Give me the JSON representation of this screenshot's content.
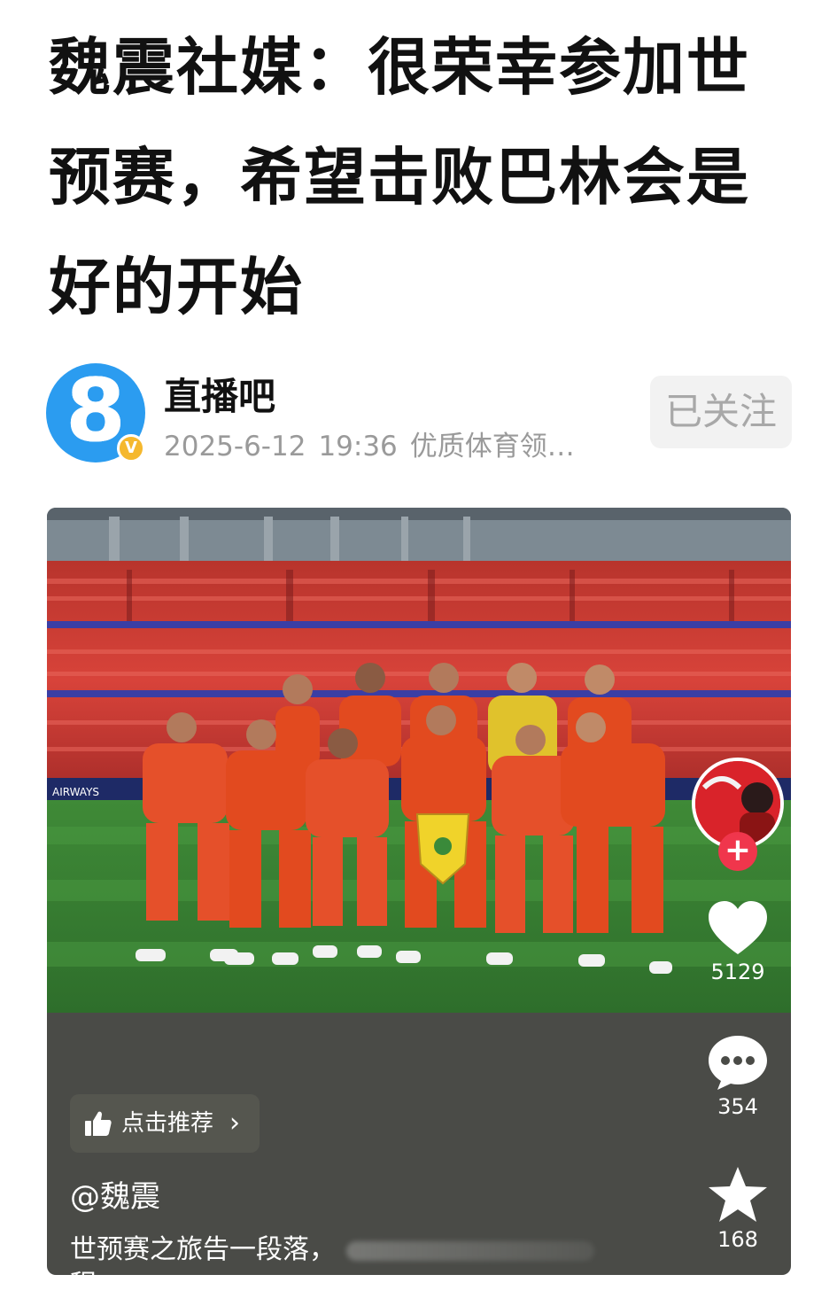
{
  "article": {
    "title": "魏震社媒：很荣幸参加世预赛，希望击败巴林会是好的开始"
  },
  "author": {
    "avatar_text": "8",
    "name": "直播吧",
    "date": "2025-6-12",
    "time": "19:36",
    "tagline": "优质体育领…",
    "follow_label": "已关注",
    "verified_icon": "verified-badge-icon"
  },
  "video": {
    "like_count": "5129",
    "comment_count": "354",
    "favorite_count": "168",
    "recommend_label": "点击推荐",
    "author_handle": "@魏震",
    "description": "世预赛之旅告一段落，",
    "description_cont": "程",
    "icons": {
      "like": "heart-icon",
      "comment": "comment-bubble-icon",
      "favorite": "star-icon",
      "recommend": "thumbs-up-icon",
      "follow": "plus-icon"
    }
  },
  "colors": {
    "avatar_blue": "#2b9cf0",
    "follow_plus": "#f0364c",
    "jersey_red": "#e24a1f",
    "card_bg": "#4a4b47"
  }
}
